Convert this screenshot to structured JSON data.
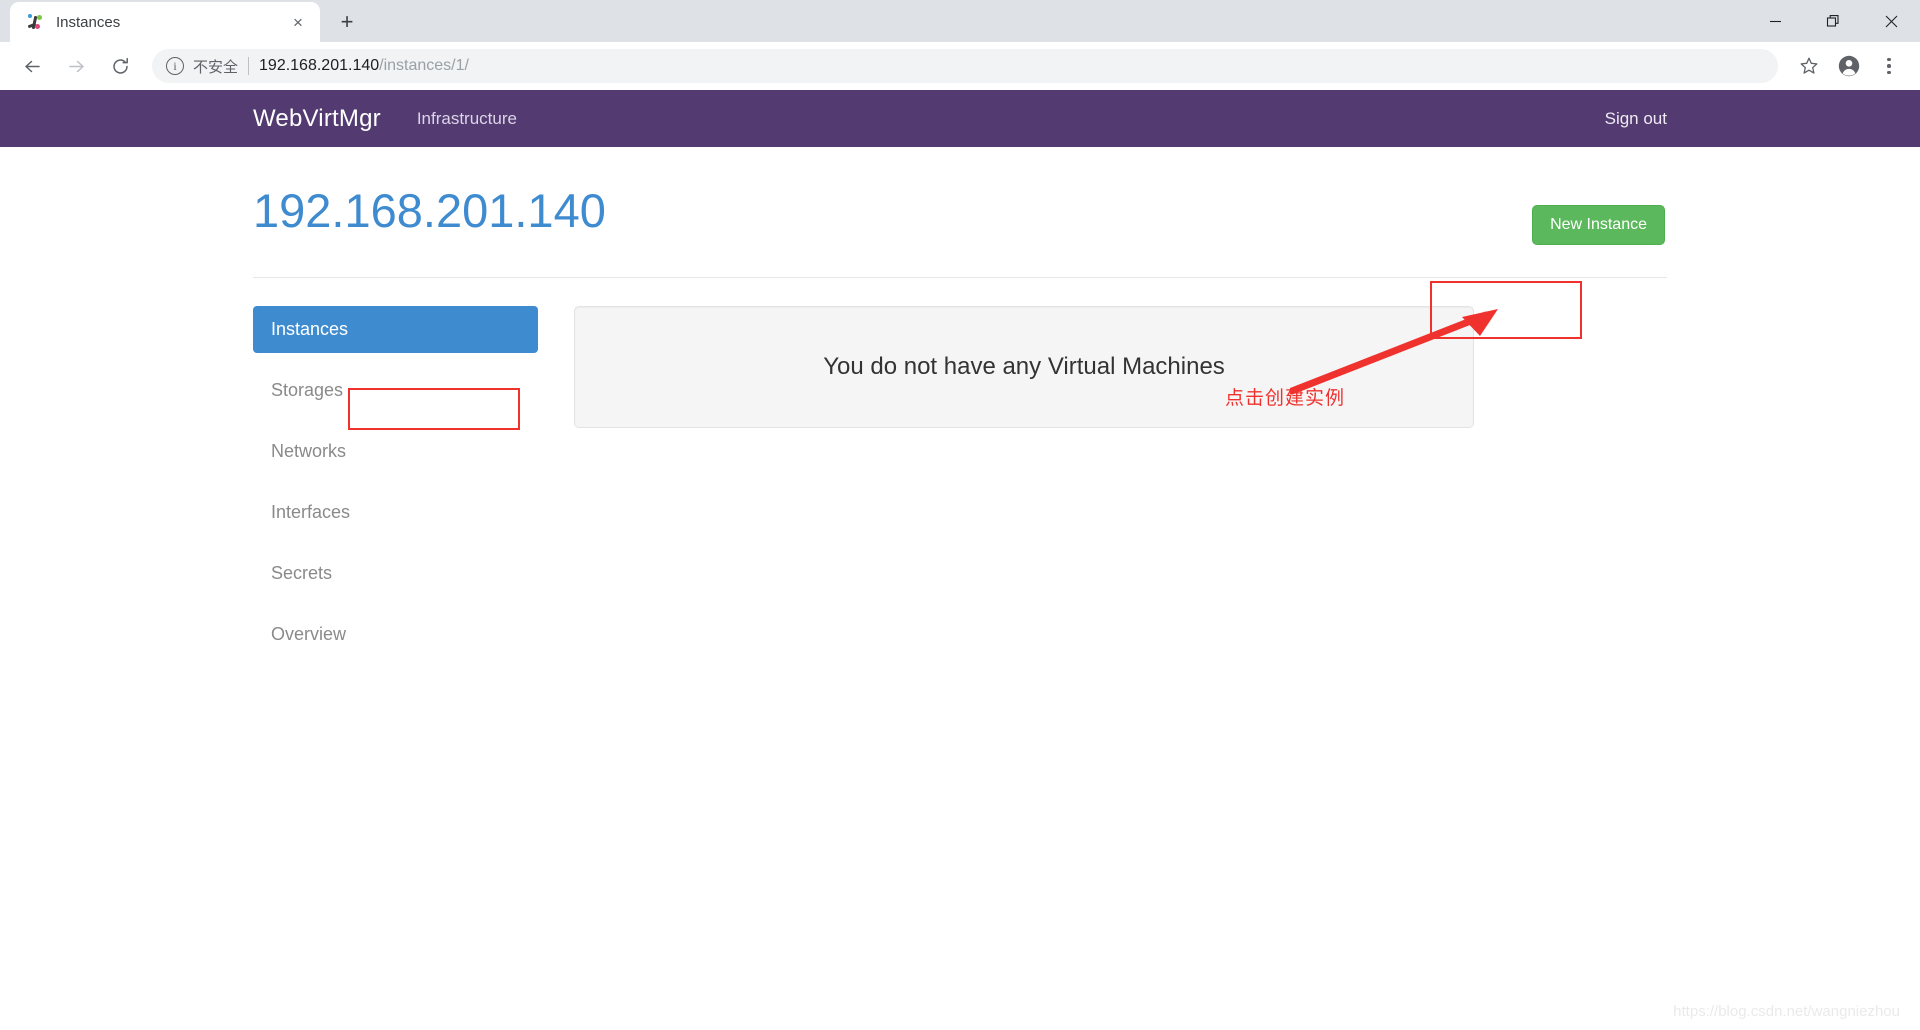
{
  "browser": {
    "tab": {
      "title": "Instances",
      "favicon": "webvirtmgr-favicon",
      "close_label": "×"
    },
    "new_tab_label": "+",
    "window_controls": {
      "minimize": "minimize-icon",
      "maximize": "restore-icon",
      "close": "close-icon"
    },
    "toolbar": {
      "back": "back-arrow-icon",
      "forward": "forward-arrow-icon",
      "reload": "reload-icon",
      "security_info_icon": "info-circle-icon",
      "security_label": "不安全",
      "url_host": "192.168.201.140",
      "url_path": "/instances/1/",
      "bookmark": "star-icon",
      "profile": "account-avatar-icon",
      "menu": "three-dot-menu-icon"
    }
  },
  "navbar": {
    "brand": "WebVirtMgr",
    "links": [
      {
        "label": "Infrastructure"
      }
    ],
    "sign_out": "Sign out",
    "bg_color": "#533b71"
  },
  "header": {
    "title": "192.168.201.140",
    "title_color": "#3f8bd0",
    "new_instance_label": "New Instance",
    "new_instance_color": "#5cb85c"
  },
  "sidebar": {
    "items": [
      {
        "label": "Instances",
        "active": true
      },
      {
        "label": "Storages",
        "active": false
      },
      {
        "label": "Networks",
        "active": false
      },
      {
        "label": "Interfaces",
        "active": false
      },
      {
        "label": "Secrets",
        "active": false
      },
      {
        "label": "Overview",
        "active": false
      }
    ],
    "active_color": "#3f8bd0"
  },
  "main": {
    "empty_message": "You do not have any Virtual Machines"
  },
  "annotations": {
    "callout_text": "点击创建实例",
    "color": "#f0322e",
    "arrow": "red-arrow-icon",
    "boxes": [
      "new-instance-highlight",
      "instances-tab-highlight"
    ]
  },
  "watermark": {
    "text": "https://blog.csdn.net/wangniezhou"
  }
}
